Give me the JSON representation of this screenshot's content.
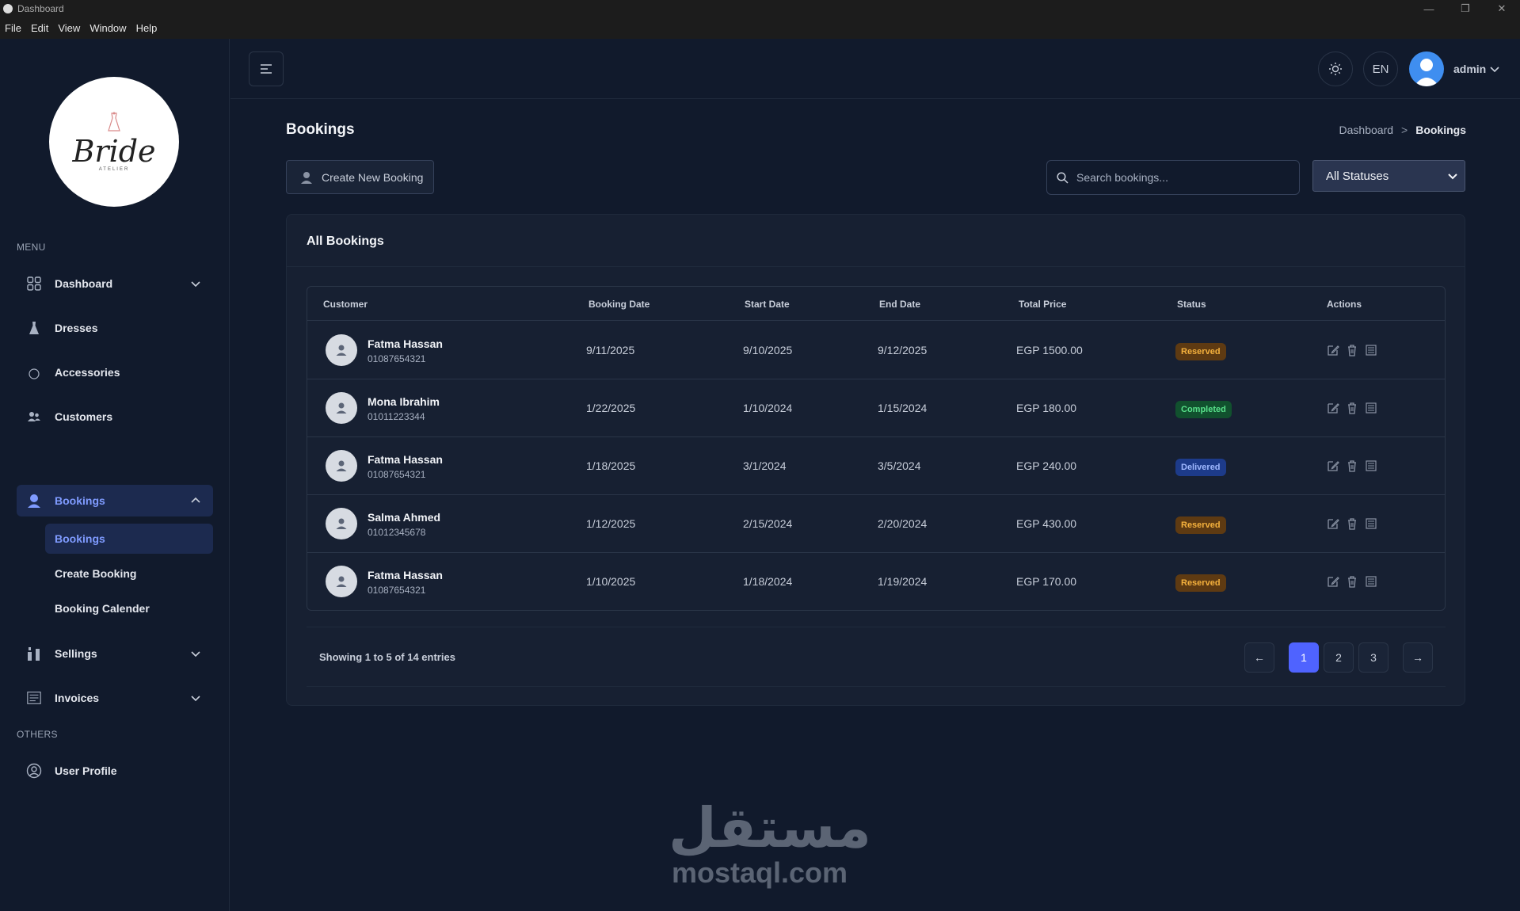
{
  "window": {
    "title": "Dashboard",
    "controls": [
      "—",
      "❐",
      "✕"
    ]
  },
  "menubar": [
    "File",
    "Edit",
    "View",
    "Window",
    "Help"
  ],
  "logo": {
    "text": "Bride",
    "subtext": "ATELIER"
  },
  "sidebar": {
    "menu_label": "MENU",
    "others_label": "OTHERS",
    "items": [
      {
        "label": "Dashboard",
        "icon": "grid-icon"
      },
      {
        "label": "Dresses",
        "icon": "dress-icon"
      },
      {
        "label": "Accessories",
        "icon": "circle-icon"
      },
      {
        "label": "Customers",
        "icon": "users-icon"
      },
      {
        "label": "Bookings",
        "icon": "booking-icon"
      },
      {
        "label": "Sellings",
        "icon": "sellings-icon"
      },
      {
        "label": "Invoices",
        "icon": "invoice-icon"
      }
    ],
    "sub_items": [
      "Bookings",
      "Create Booking",
      "Booking Calender"
    ],
    "profile_label": "User Profile"
  },
  "header": {
    "language": "EN",
    "user_name": "admin"
  },
  "page": {
    "title": "Bookings",
    "breadcrumb": {
      "parent": "Dashboard",
      "separator": ">",
      "current": "Bookings"
    },
    "create_button": "Create New Booking",
    "search_placeholder": "Search bookings...",
    "status_filter": "All Statuses"
  },
  "table": {
    "title": "All Bookings",
    "headers": [
      "Customer",
      "Booking Date",
      "Start Date",
      "End Date",
      "Total Price",
      "Status",
      "Actions"
    ],
    "rows": [
      {
        "name": "Fatma Hassan",
        "phone": "01087654321",
        "booking_date": "9/11/2025",
        "start_date": "9/10/2025",
        "end_date": "9/12/2025",
        "price": "EGP 1500.00",
        "status": "Reserved"
      },
      {
        "name": "Mona Ibrahim",
        "phone": "01011223344",
        "booking_date": "1/22/2025",
        "start_date": "1/10/2024",
        "end_date": "1/15/2024",
        "price": "EGP 180.00",
        "status": "Completed"
      },
      {
        "name": "Fatma Hassan",
        "phone": "01087654321",
        "booking_date": "1/18/2025",
        "start_date": "3/1/2024",
        "end_date": "3/5/2024",
        "price": "EGP 240.00",
        "status": "Delivered"
      },
      {
        "name": "Salma Ahmed",
        "phone": "01012345678",
        "booking_date": "1/12/2025",
        "start_date": "2/15/2024",
        "end_date": "2/20/2024",
        "price": "EGP 430.00",
        "status": "Reserved"
      },
      {
        "name": "Fatma Hassan",
        "phone": "01087654321",
        "booking_date": "1/10/2025",
        "start_date": "1/18/2024",
        "end_date": "1/19/2024",
        "price": "EGP 170.00",
        "status": "Reserved"
      }
    ]
  },
  "pagination": {
    "summary": "Showing 1 to 5 of 14 entries",
    "prev": "←",
    "next": "→",
    "pages": [
      "1",
      "2",
      "3"
    ],
    "current": "1"
  },
  "watermark": {
    "arabic": "مستقل",
    "latin": "mostaql.com"
  },
  "colors": {
    "background": "#111a2c",
    "accent": "#4f63ff",
    "reserved": "#f5b13d",
    "completed": "#58e08a",
    "delivered": "#9fb8ff"
  }
}
